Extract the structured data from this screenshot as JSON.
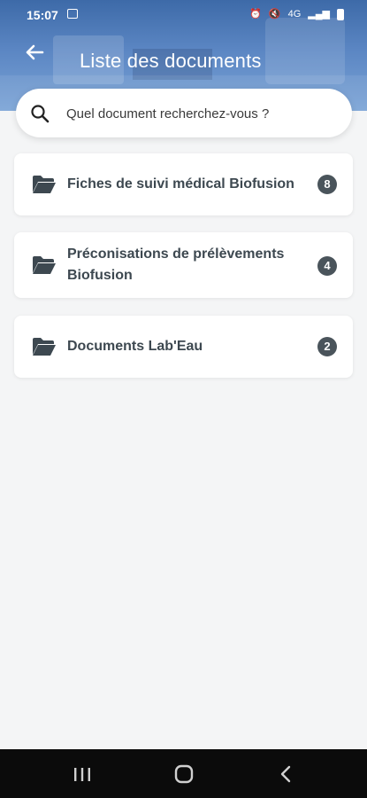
{
  "status_bar": {
    "time": "15:07",
    "signal": "4G"
  },
  "header": {
    "title": "Liste des documents",
    "back_icon": "arrow-left-icon"
  },
  "search": {
    "placeholder": "Quel document recherchez-vous ?",
    "icon": "search-icon"
  },
  "documents": [
    {
      "label": "Fiches de suivi médical Biofusion",
      "count": "8"
    },
    {
      "label": "Préconisations de prélèvements Biofusion",
      "count": "4"
    },
    {
      "label": "Documents Lab'Eau",
      "count": "2"
    }
  ],
  "nav": {
    "items": [
      "recents-icon",
      "home-icon",
      "back-icon"
    ]
  },
  "colors": {
    "header": "#4a78b8",
    "badge": "#4a545b",
    "background": "#f4f5f6",
    "text": "#3d4850"
  }
}
